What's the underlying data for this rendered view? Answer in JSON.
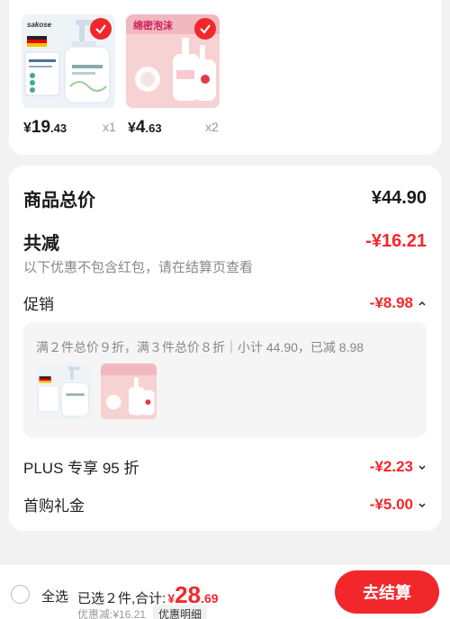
{
  "items": [
    {
      "price_symbol": "¥",
      "price_int": "19",
      "price_dec": ".43",
      "qty": "x1",
      "brand": "sakose"
    },
    {
      "price_symbol": "¥",
      "price_int": "4",
      "price_dec": ".63",
      "qty": "x2",
      "label": "绵密泡沫"
    }
  ],
  "summary": {
    "goods_total_label": "商品总价",
    "goods_total_value": "¥44.90",
    "discount_label": "共减",
    "discount_value": "-¥16.21",
    "discount_note": "以下优惠不包含红包，请在结算页查看",
    "promo_label": "促销",
    "promo_value": "-¥8.98",
    "promo_detail": "满２件总价９折，满３件总价８折｜小计 44.90，已减 8.98",
    "plus_label": "PLUS 专享 95 折",
    "plus_value": "-¥2.23",
    "first_label": "首购礼金",
    "first_value": "-¥5.00"
  },
  "bottom": {
    "select_all": "全选",
    "selected_text": "已选２件,合计:",
    "total_symbol": "¥",
    "total_int": "28",
    "total_dec": ".69",
    "discount_text": "优惠减:¥16.21",
    "detail_label": "优惠明细",
    "checkout_label": "去结算"
  },
  "colors": {
    "accent": "#f2272c"
  }
}
